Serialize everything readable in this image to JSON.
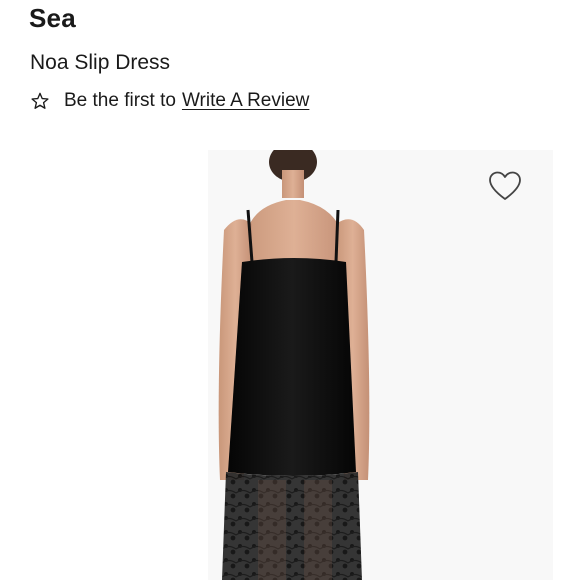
{
  "product": {
    "brand": "Sea",
    "name": "Noa Slip Dress"
  },
  "reviews": {
    "prompt": "Be the first to",
    "link_label": "Write A Review",
    "star_icon": "star-outline-icon"
  },
  "gallery": {
    "favorite_icon": "heart-outline-icon",
    "image_subject": "model-back-view-black-slip-dress-with-lace-hem"
  },
  "colors": {
    "text": "#1a1a1a",
    "dress": "#0d0d0d",
    "skin": "#d8a888"
  }
}
